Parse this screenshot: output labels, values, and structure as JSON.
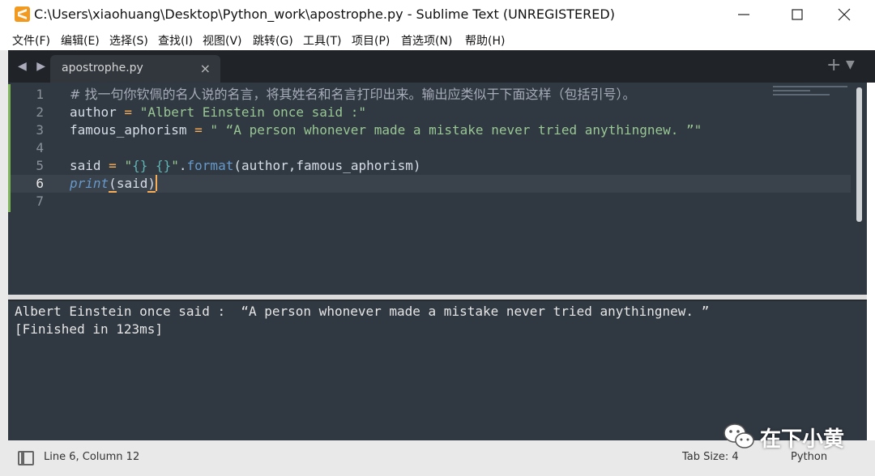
{
  "window": {
    "title": "C:\\Users\\xiaohuang\\Desktop\\Python_work\\apostrophe.py - Sublime Text (UNREGISTERED)",
    "controls": {
      "minimize": "minimize",
      "maximize": "maximize",
      "close": "close"
    }
  },
  "menu": [
    "文件(F)",
    "编辑(E)",
    "选择(S)",
    "查找(I)",
    "视图(V)",
    "跳转(G)",
    "工具(T)",
    "项目(P)",
    "首选项(N)",
    "帮助(H)"
  ],
  "tabs": {
    "active": "apostrophe.py",
    "close_glyph": "×",
    "add_glyph": "+",
    "menu_glyph": "▼",
    "nav_glyph": "◀ ▶"
  },
  "editor": {
    "line_numbers": [
      "1",
      "2",
      "3",
      "4",
      "5",
      "6",
      "7"
    ],
    "active_line": 6,
    "code": {
      "l1_comment": "# 找一句你钦佩的名人说的名言，将其姓名和名言打印出来。输出应类似于下面这样（包括引号）。",
      "l2_name": "author",
      "l2_op": " = ",
      "l2_str": "\"Albert Einstein once said :\"",
      "l3_name": "famous_aphorism",
      "l3_op": " = ",
      "l3_str": "\" “A person whonever made a mistake never tried anythingnew. ”\"",
      "l5_name": "said",
      "l5_op": " = ",
      "l5_q1": "\"",
      "l5_b1": "{}",
      "l5_sp": " ",
      "l5_b2": "{}",
      "l5_q2": "\"",
      "l5_dot": ".",
      "l5_fn": "format",
      "l5_args": "(author,famous_aphorism)",
      "l6_fn": "print",
      "l6_open": "(",
      "l6_arg": "said",
      "l6_close": ")"
    }
  },
  "output": {
    "lines": [
      "Albert Einstein once said :  “A person whonever made a mistake never tried anythingnew. ”",
      "[Finished in 123ms]"
    ]
  },
  "status": {
    "position": "Line 6, Column 12",
    "tab_size": "Tab Size: 4",
    "syntax": "Python"
  },
  "watermark": {
    "text": "在下小黄",
    "icon": "wechat-icon"
  },
  "colors": {
    "editor_bg": "#303841",
    "tabbar_bg": "#202428",
    "string": "#99c794",
    "operator": "#f9ae58",
    "function": "#6699cc",
    "app_icon": "#f29a1f"
  }
}
